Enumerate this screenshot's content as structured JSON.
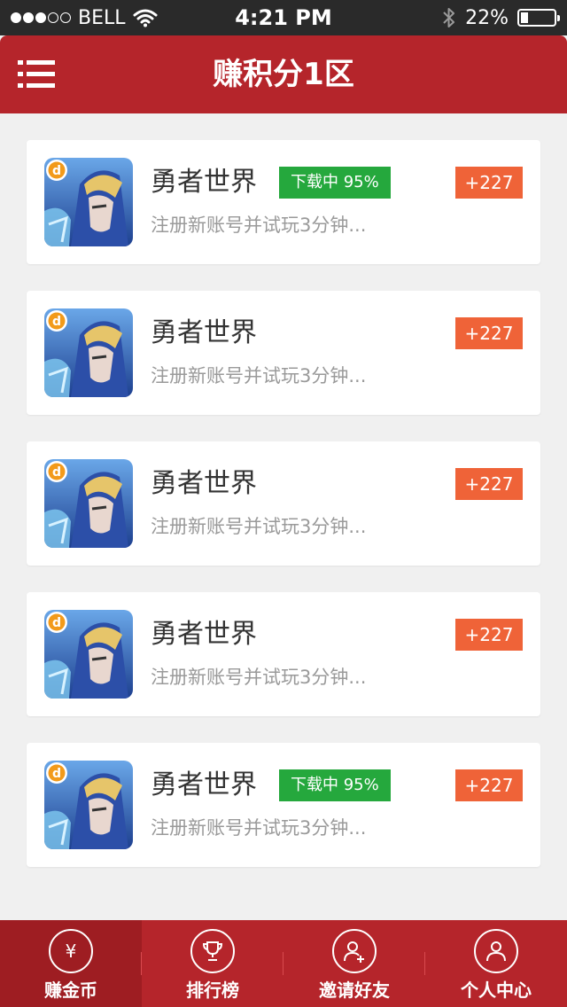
{
  "status_bar": {
    "carrier": "BELL",
    "signal_bars": 3,
    "signal_total": 5,
    "time": "4:21 PM",
    "battery_text": "22%",
    "battery_level": 0.22
  },
  "header": {
    "title": "赚积分1区",
    "menu_icon": "menu-icon"
  },
  "tasks": [
    {
      "name": "勇者世界",
      "badge": "下载中 95%",
      "desc": "注册新账号并试玩3分钟...",
      "points": "+227"
    },
    {
      "name": "勇者世界",
      "badge": "",
      "desc": "注册新账号并试玩3分钟...",
      "points": "+227"
    },
    {
      "name": "勇者世界",
      "badge": "",
      "desc": "注册新账号并试玩3分钟...",
      "points": "+227"
    },
    {
      "name": "勇者世界",
      "badge": "",
      "desc": "注册新账号并试玩3分钟...",
      "points": "+227"
    },
    {
      "name": "勇者世界",
      "badge": "下载中 95%",
      "desc": "注册新账号并试玩3分钟...",
      "points": "+227"
    }
  ],
  "tab_bar": {
    "tabs": [
      {
        "label": "赚金币",
        "icon": "yen-icon",
        "glyph": "¥",
        "active": true
      },
      {
        "label": "排行榜",
        "icon": "trophy-icon",
        "glyph": "",
        "active": false
      },
      {
        "label": "邀请好友",
        "icon": "add-user-icon",
        "glyph": "",
        "active": false
      },
      {
        "label": "个人中心",
        "icon": "user-icon",
        "glyph": "",
        "active": false
      }
    ]
  },
  "colors": {
    "header_red": "#b5252b",
    "active_tab_red": "#9e1d22",
    "badge_green": "#25a83d",
    "points_orange": "#ef6338",
    "background": "#f0f0f0"
  }
}
